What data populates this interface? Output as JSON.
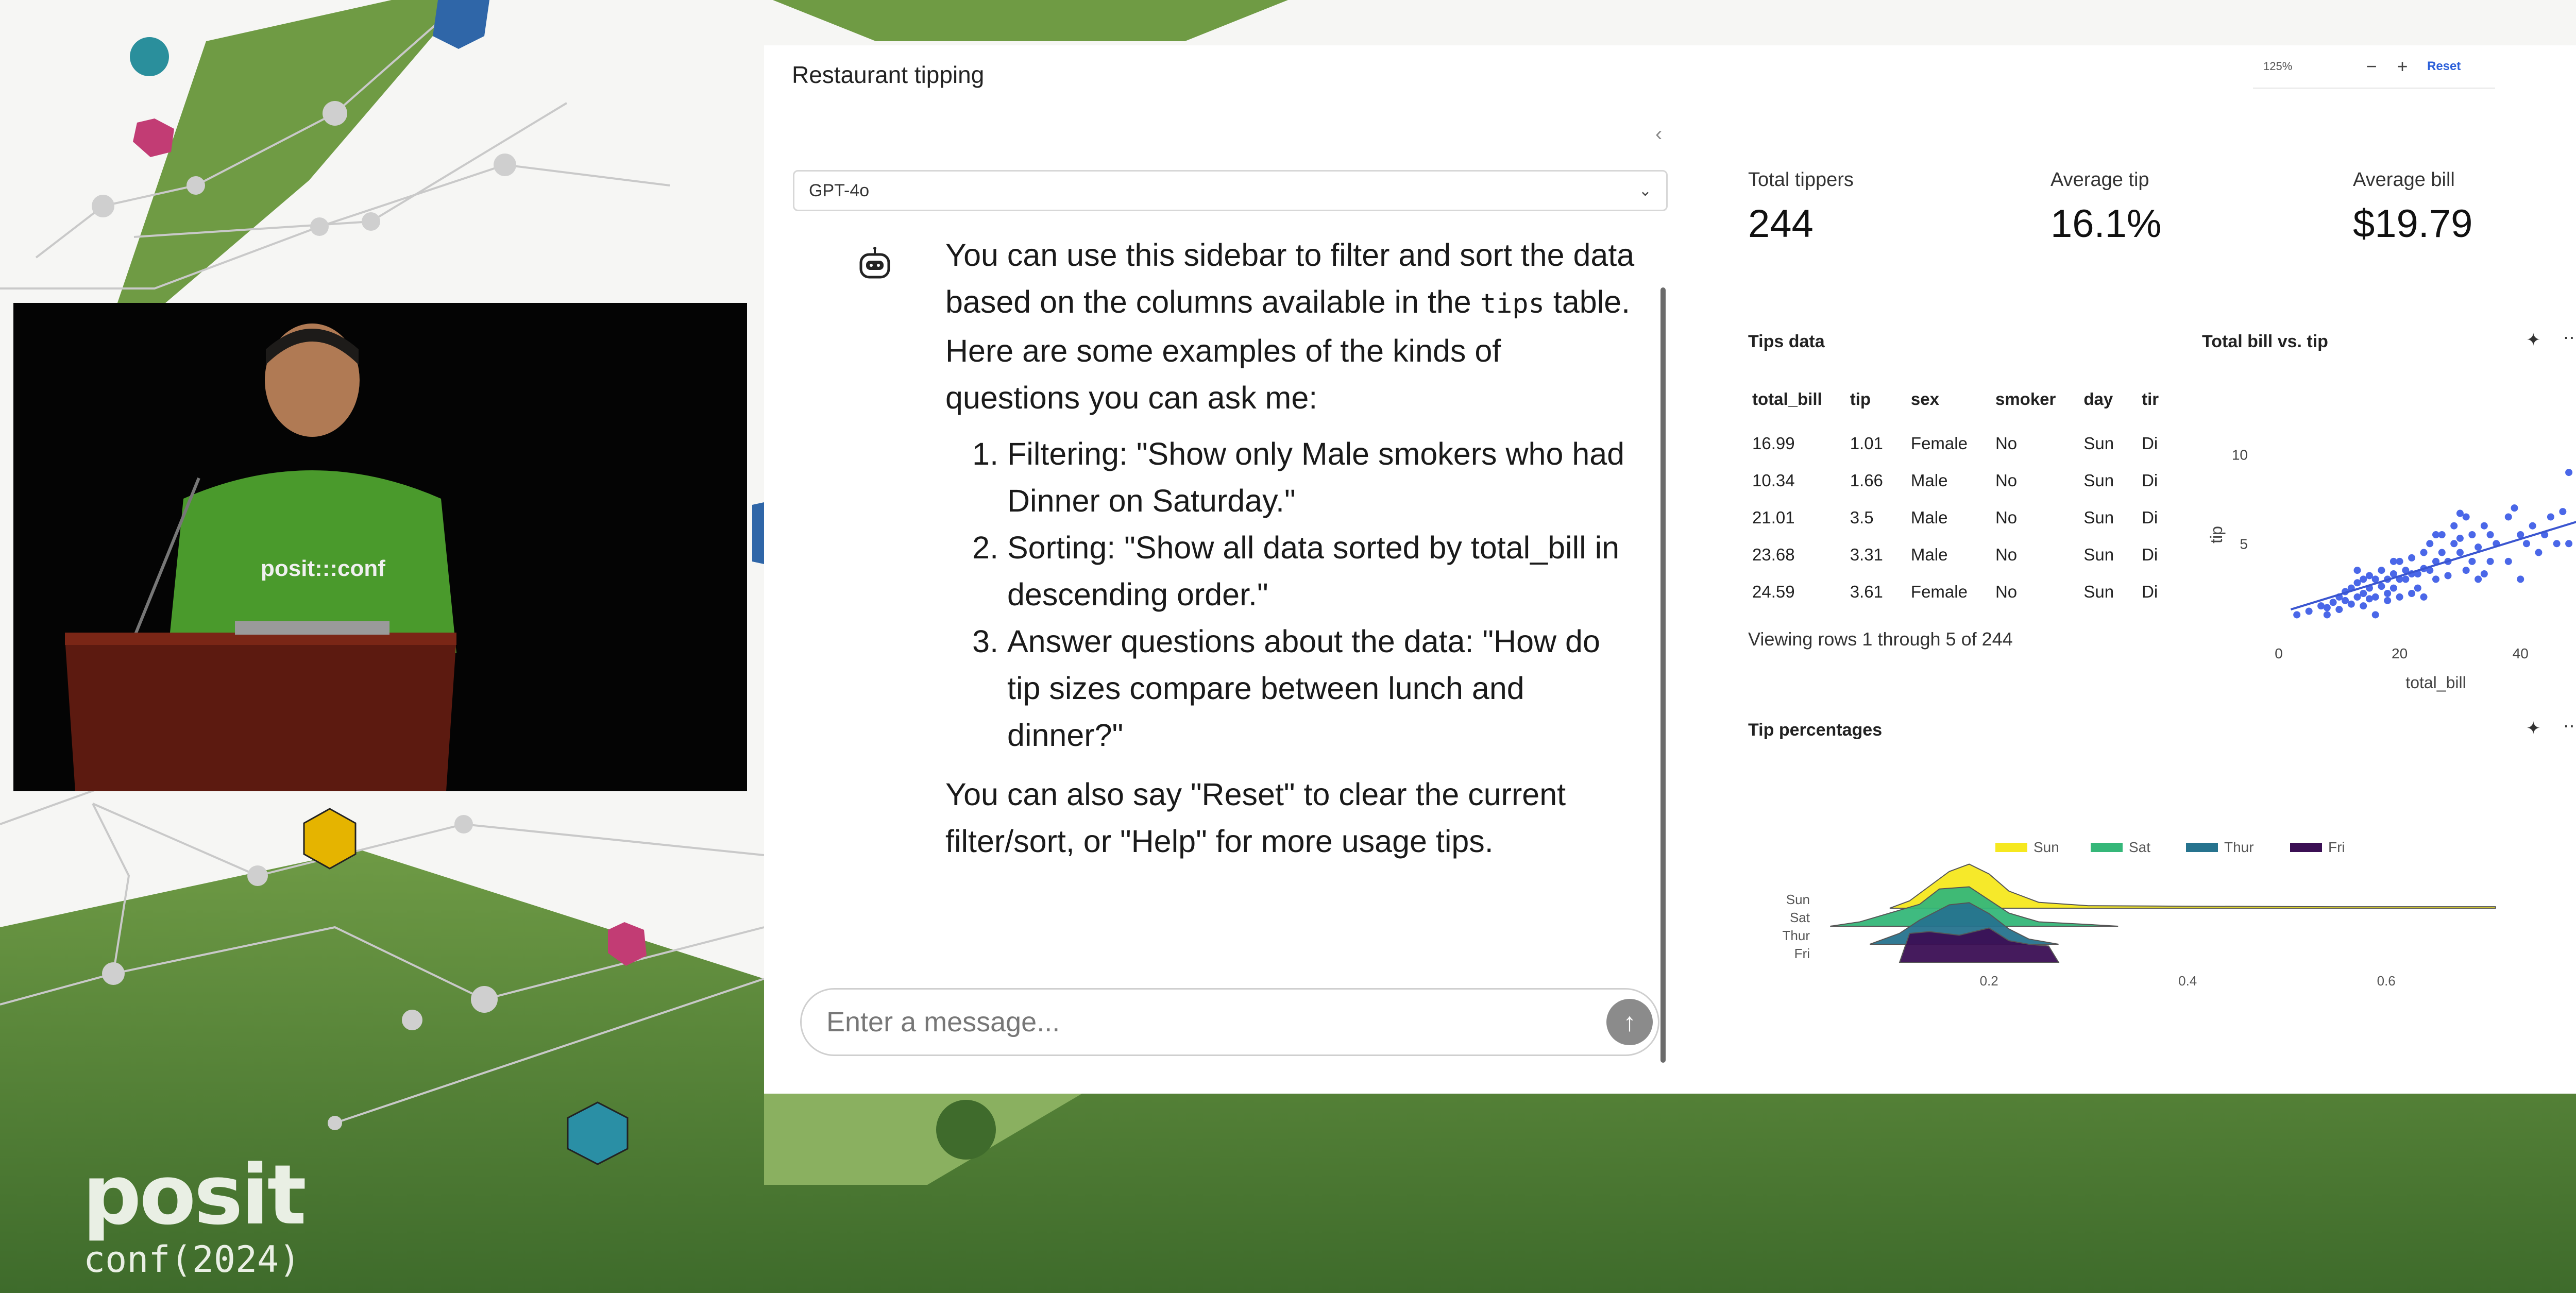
{
  "app": {
    "title": "Restaurant tipping",
    "zoom": {
      "level": "125%",
      "minus": "−",
      "plus": "+",
      "reset": "Reset"
    },
    "collapse_icon": "chevron-left-icon"
  },
  "sidebar": {
    "model": "GPT-4o",
    "message": {
      "intro_before_code": "You can use this sidebar to filter and sort the data based on the columns available in the ",
      "code": "tips",
      "intro_after_code": " table. Here are some examples of the kinds of questions you can ask me:",
      "items": [
        "Filtering: \"Show only Male smokers who had Dinner on Saturday.\"",
        "Sorting: \"Show all data sorted by total_bill in descending order.\"",
        "Answer questions about the data: \"How do tip sizes compare between lunch and dinner?\""
      ],
      "outro": "You can also say \"Reset\" to clear the current filter/sort, or \"Help\" for more usage tips."
    },
    "input_placeholder": "Enter a message..."
  },
  "value_boxes": [
    {
      "label": "Total tippers",
      "value": "244"
    },
    {
      "label": "Average tip",
      "value": "16.1%"
    },
    {
      "label": "Average bill",
      "value": "$19.79"
    }
  ],
  "tips_table": {
    "title": "Tips data",
    "columns": [
      "total_bill",
      "tip",
      "sex",
      "smoker",
      "day",
      "tir"
    ],
    "rows": [
      [
        "16.99",
        "1.01",
        "Female",
        "No",
        "Sun",
        "Di"
      ],
      [
        "10.34",
        "1.66",
        "Male",
        "No",
        "Sun",
        "Di"
      ],
      [
        "21.01",
        "3.5",
        "Male",
        "No",
        "Sun",
        "Di"
      ],
      [
        "23.68",
        "3.31",
        "Male",
        "No",
        "Sun",
        "Di"
      ],
      [
        "24.59",
        "3.61",
        "Female",
        "No",
        "Sun",
        "Di"
      ]
    ],
    "footer": "Viewing rows 1 through 5 of 244"
  },
  "chart_data": [
    {
      "type": "scatter",
      "title": "Total bill vs. tip",
      "xlabel": "total_bill",
      "ylabel": "tip",
      "xticks": [
        "0",
        "20",
        "40"
      ],
      "yticks": [
        "5",
        "10"
      ],
      "xlim": [
        0,
        52
      ],
      "ylim": [
        0,
        11
      ],
      "color": "#4a67e8",
      "points": [
        [
          3,
          1
        ],
        [
          5,
          1.2
        ],
        [
          7,
          1.5
        ],
        [
          8,
          1.4
        ],
        [
          9,
          1.7
        ],
        [
          10,
          1.3
        ],
        [
          10,
          2
        ],
        [
          11,
          1.8
        ],
        [
          11,
          2.3
        ],
        [
          12,
          1.6
        ],
        [
          12,
          2.5
        ],
        [
          13,
          2.0
        ],
        [
          13,
          2.8
        ],
        [
          14,
          2.2
        ],
        [
          14,
          3.0
        ],
        [
          15,
          2.5
        ],
        [
          15,
          3.2
        ],
        [
          16,
          2.0
        ],
        [
          16,
          3.0
        ],
        [
          16,
          1.0
        ],
        [
          17,
          2.6
        ],
        [
          17,
          3.5
        ],
        [
          18,
          2.2
        ],
        [
          18,
          3.0
        ],
        [
          19,
          3.3
        ],
        [
          19,
          2.5
        ],
        [
          20,
          3.0
        ],
        [
          20,
          2.0
        ],
        [
          20,
          4.0
        ],
        [
          21,
          3.5
        ],
        [
          21,
          3.0
        ],
        [
          22,
          3.3
        ],
        [
          22,
          4.2
        ],
        [
          23,
          3.3
        ],
        [
          23,
          2.5
        ],
        [
          24,
          3.6
        ],
        [
          24,
          4.5
        ],
        [
          25,
          3.5
        ],
        [
          25,
          5.0
        ],
        [
          26,
          4.0
        ],
        [
          26,
          3.0
        ],
        [
          27,
          4.5
        ],
        [
          27,
          5.5
        ],
        [
          28,
          4.0
        ],
        [
          28,
          3.2
        ],
        [
          29,
          5.0
        ],
        [
          29,
          6.0
        ],
        [
          30,
          4.5
        ],
        [
          30,
          5.3
        ],
        [
          31,
          3.5
        ],
        [
          31,
          6.5
        ],
        [
          32,
          4.0
        ],
        [
          32,
          5.5
        ],
        [
          33,
          4.8
        ],
        [
          34,
          6.0
        ],
        [
          34,
          3.3
        ],
        [
          35,
          5.5
        ],
        [
          35,
          4.0
        ],
        [
          36,
          5.0
        ],
        [
          38,
          6.5
        ],
        [
          38,
          4.0
        ],
        [
          39,
          7.0
        ],
        [
          40,
          5.5
        ],
        [
          40,
          3.0
        ],
        [
          41,
          5.0
        ],
        [
          42,
          6.0
        ],
        [
          43,
          4.5
        ],
        [
          44,
          5.5
        ],
        [
          45,
          6.5
        ],
        [
          46,
          5.0
        ],
        [
          47,
          6.8
        ],
        [
          48,
          9.0
        ],
        [
          48,
          5.0
        ],
        [
          50,
          10.0
        ],
        [
          8,
          1.0
        ],
        [
          14,
          1.5
        ],
        [
          18,
          1.8
        ],
        [
          22,
          2.2
        ],
        [
          24,
          2.0
        ],
        [
          26,
          5.5
        ],
        [
          30,
          6.7
        ],
        [
          33,
          3.0
        ],
        [
          15,
          1.9
        ],
        [
          19,
          4.0
        ],
        [
          13,
          3.5
        ]
      ],
      "trend": [
        [
          2,
          1.3
        ],
        [
          50,
          6.3
        ]
      ]
    },
    {
      "type": "area",
      "title": "Tip percentages",
      "legend": [
        {
          "name": "Sun",
          "color": "#f6e81f"
        },
        {
          "name": "Sat",
          "color": "#35b779"
        },
        {
          "name": "Thur",
          "color": "#26738e"
        },
        {
          "name": "Fri",
          "color": "#3b0f54"
        }
      ],
      "categories": [
        "Sun",
        "Sat",
        "Thur",
        "Fri"
      ],
      "xticks": [
        "0.2",
        "0.4",
        "0.6"
      ],
      "xlim": [
        0.03,
        0.72
      ],
      "series": [
        {
          "name": "Sun",
          "x": [
            0.1,
            0.12,
            0.14,
            0.16,
            0.18,
            0.2,
            0.22,
            0.25,
            0.3,
            0.4,
            0.55,
            0.71
          ],
          "y": [
            0,
            0.15,
            0.45,
            0.75,
            0.9,
            0.7,
            0.35,
            0.12,
            0.05,
            0.04,
            0.03,
            0.03
          ]
        },
        {
          "name": "Sat",
          "x": [
            0.04,
            0.07,
            0.1,
            0.13,
            0.15,
            0.18,
            0.2,
            0.22,
            0.25,
            0.3,
            0.33
          ],
          "y": [
            0,
            0.1,
            0.3,
            0.5,
            0.85,
            0.9,
            0.6,
            0.3,
            0.1,
            0.04,
            0.0
          ]
        },
        {
          "name": "Thur",
          "x": [
            0.08,
            0.11,
            0.13,
            0.16,
            0.18,
            0.2,
            0.22,
            0.24,
            0.27
          ],
          "y": [
            0,
            0.25,
            0.55,
            0.9,
            0.95,
            0.7,
            0.35,
            0.12,
            0.0
          ]
        },
        {
          "name": "Fri",
          "x": [
            0.11,
            0.12,
            0.14,
            0.17,
            0.2,
            0.22,
            0.24,
            0.26,
            0.27
          ],
          "y": [
            0,
            0.8,
            0.85,
            0.75,
            0.95,
            0.6,
            0.5,
            0.45,
            0.0
          ]
        }
      ]
    }
  ],
  "chart_icons": {
    "sparkle": "sparkle-icon",
    "more": "more-icon"
  },
  "branding": {
    "logo": "posit",
    "event": "conf(2024)"
  }
}
